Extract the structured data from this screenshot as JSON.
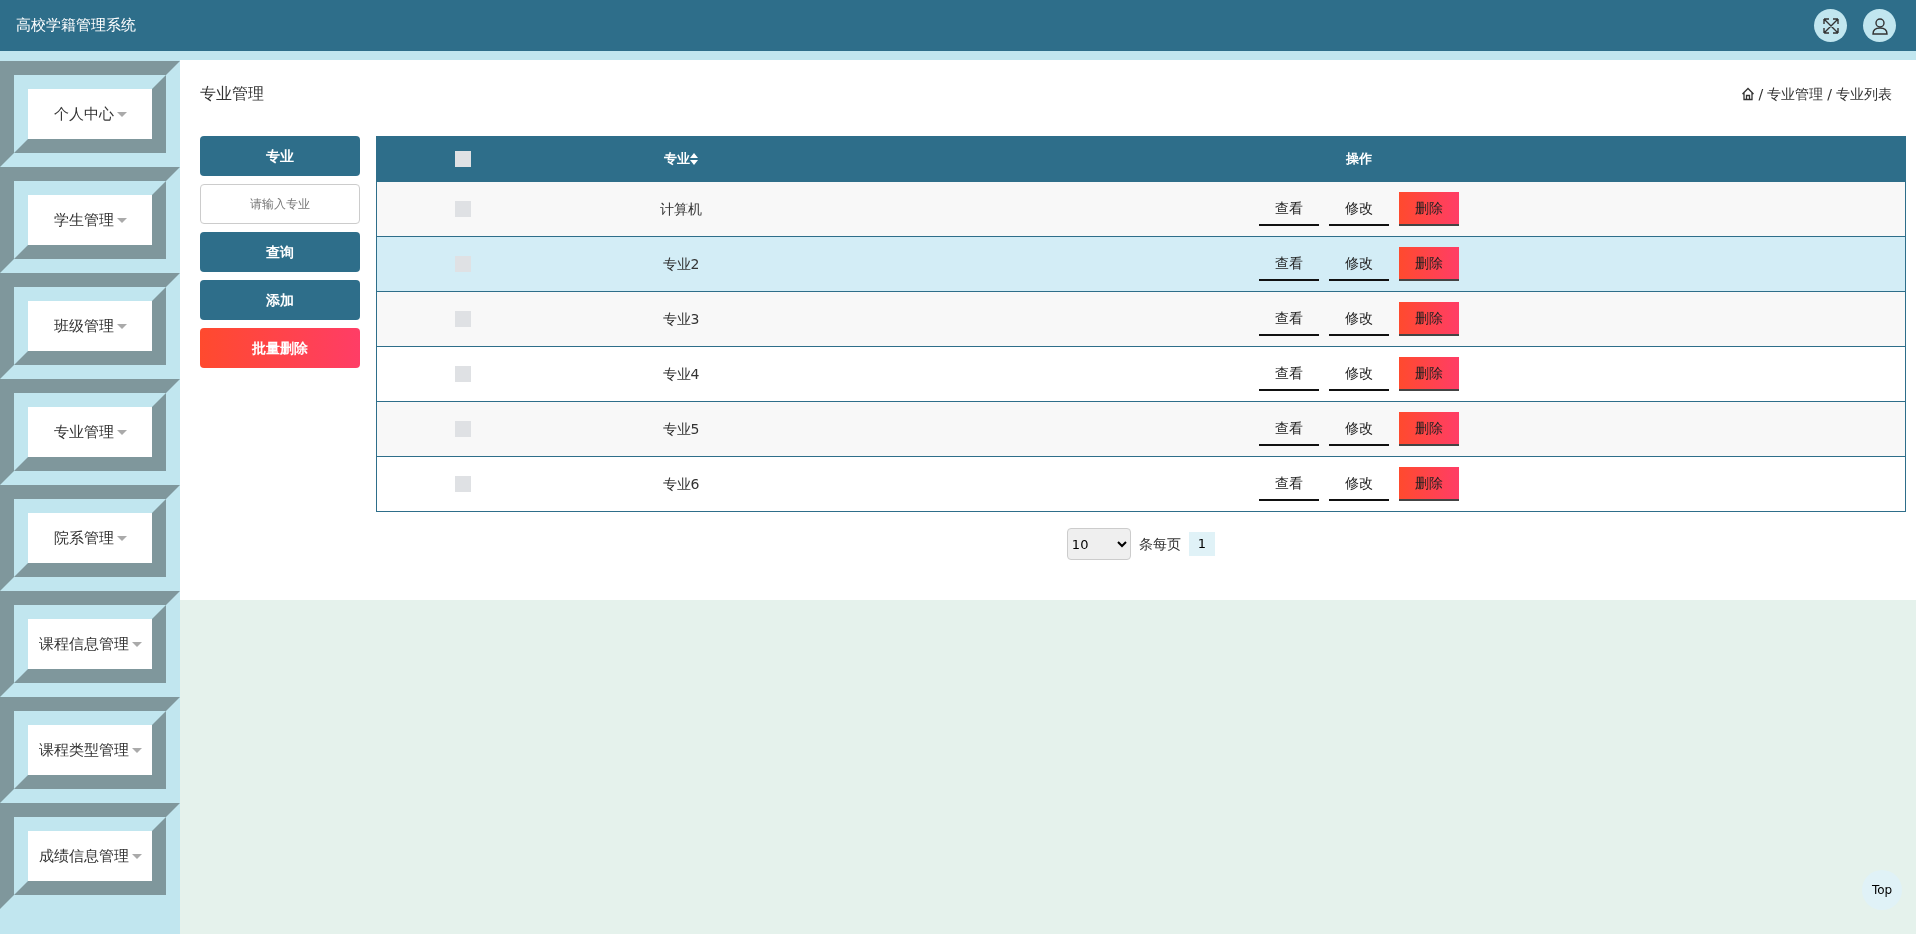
{
  "header": {
    "title": "高校学籍管理系统"
  },
  "sidebar": {
    "items": [
      {
        "label": "个人中心"
      },
      {
        "label": "学生管理"
      },
      {
        "label": "班级管理"
      },
      {
        "label": "专业管理"
      },
      {
        "label": "院系管理"
      },
      {
        "label": "课程信息管理"
      },
      {
        "label": "课程类型管理"
      },
      {
        "label": "成绩信息管理"
      }
    ]
  },
  "page_title": "专业管理",
  "breadcrumb": {
    "separator": "/",
    "items": [
      "专业管理",
      "专业列表"
    ]
  },
  "search": {
    "label": "专业",
    "placeholder": "请输入专业",
    "buttons": [
      {
        "label": "查询",
        "kind": "primary"
      },
      {
        "label": "添加",
        "kind": "primary"
      },
      {
        "label": "批量删除",
        "kind": "danger"
      }
    ]
  },
  "table": {
    "select_all_checked": false,
    "columns": [
      "专业",
      "操作"
    ],
    "rows": [
      {
        "checked": false,
        "highlighted": false,
        "name": "计算机",
        "actions": [
          {
            "label": "查看",
            "kind": "plain"
          },
          {
            "label": "修改",
            "kind": "plain"
          },
          {
            "label": "删除",
            "kind": "danger"
          }
        ]
      },
      {
        "checked": false,
        "highlighted": true,
        "name": "专业2",
        "actions": [
          {
            "label": "查看",
            "kind": "plain"
          },
          {
            "label": "修改",
            "kind": "plain"
          },
          {
            "label": "删除",
            "kind": "danger"
          }
        ]
      },
      {
        "checked": false,
        "highlighted": false,
        "name": "专业3",
        "actions": [
          {
            "label": "查看",
            "kind": "plain"
          },
          {
            "label": "修改",
            "kind": "plain"
          },
          {
            "label": "删除",
            "kind": "danger"
          }
        ]
      },
      {
        "checked": false,
        "highlighted": false,
        "name": "专业4",
        "actions": [
          {
            "label": "查看",
            "kind": "plain"
          },
          {
            "label": "修改",
            "kind": "plain"
          },
          {
            "label": "删除",
            "kind": "danger"
          }
        ]
      },
      {
        "checked": false,
        "highlighted": false,
        "name": "专业5",
        "actions": [
          {
            "label": "查看",
            "kind": "plain"
          },
          {
            "label": "修改",
            "kind": "plain"
          },
          {
            "label": "删除",
            "kind": "danger"
          }
        ]
      },
      {
        "checked": false,
        "highlighted": false,
        "name": "专业6",
        "actions": [
          {
            "label": "查看",
            "kind": "plain"
          },
          {
            "label": "修改",
            "kind": "plain"
          },
          {
            "label": "删除",
            "kind": "danger"
          }
        ]
      }
    ]
  },
  "pagination": {
    "page_size": "10",
    "page_size_label": "条每页",
    "pages": [
      {
        "label": "1",
        "selected": true
      }
    ]
  },
  "back_to_top": "Top"
}
